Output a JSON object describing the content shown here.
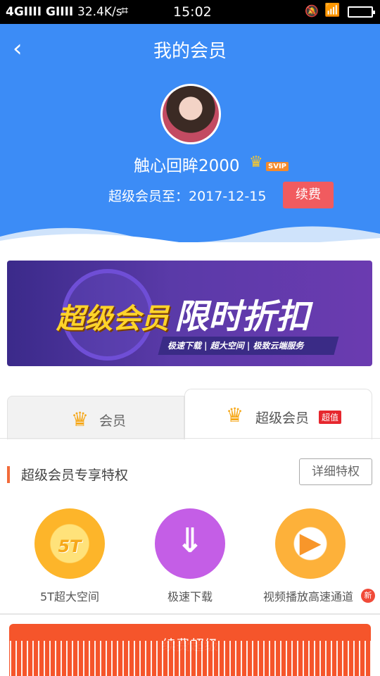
{
  "status_bar": {
    "signal": "4GIIII GIIII",
    "speed": "32.4K/s",
    "crop_icon": "crop-icon",
    "time": "15:02",
    "icons": [
      "mute-icon",
      "wifi-icon",
      "battery-icon"
    ]
  },
  "header": {
    "back_icon": "chevron-left-icon",
    "title": "我的会员",
    "username": "触心回眸2000",
    "vip_badge": "SVIP",
    "expire_text": "超级会员至：2017-12-15",
    "renew_label": "续费",
    "colors": {
      "background": "#3c8cf6",
      "renew": "#f15b5f"
    }
  },
  "banner": {
    "headline_left": "超级会员",
    "headline_right": "限时折扣",
    "subline": "极速下载 | 超大空间 | 极致云端服务"
  },
  "tabs": [
    {
      "label": "会员",
      "icon": "crown-icon",
      "active": false
    },
    {
      "label": "超级会员",
      "icon": "crown-icon",
      "badge": "超值",
      "active": true
    }
  ],
  "section": {
    "title": "超级会员专享特权",
    "detail_label": "详细特权"
  },
  "features": [
    {
      "label": "5T超大空间",
      "icon_text": "5T",
      "icon": "storage-medal-icon"
    },
    {
      "label": "极速下载",
      "icon_text": "⇓",
      "icon": "download-icon"
    },
    {
      "label": "视频播放高速通道",
      "icon_text": "▶",
      "icon": "video-play-icon",
      "badge": "新"
    }
  ],
  "bottom_button": {
    "label": "续费超级"
  }
}
